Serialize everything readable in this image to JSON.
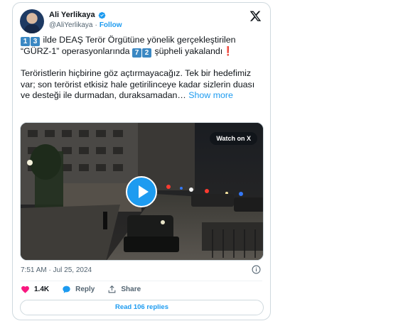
{
  "author": {
    "name": "Ali Yerlikaya",
    "handle": "@AliYerlikaya",
    "follow_label": "Follow",
    "separator": "·"
  },
  "tweet": {
    "line1_keycaps": [
      "1",
      "3"
    ],
    "line1_text": " ilde DEAŞ Terör Örgütüne yönelik gerçekleştirilen",
    "line2_text": "“GÜRZ-1” operasyonlarında ",
    "line2_keycaps": [
      "7",
      "2"
    ],
    "line2_tail": " şüpheli yakalandı",
    "line2_emoji": "❗",
    "para2": "Teröristlerin hiçbirine göz açtırmayacağız. Tek bir hedefimiz var; son terörist etkisiz hale getirilinceye kadar sizlerin duası ve desteği ile durmadan, duraksamadan…",
    "show_more": "Show more"
  },
  "media": {
    "watch_label": "Watch on X"
  },
  "meta": {
    "time": "7:51 AM",
    "separator": "·",
    "date": "Jul 25, 2024"
  },
  "actions": {
    "like_count": "1.4K",
    "reply_label": "Reply",
    "share_label": "Share"
  },
  "footer": {
    "read_replies": "Read 106 replies"
  },
  "colors": {
    "accent": "#1d9bf0",
    "like": "#f91880",
    "text_secondary": "#536471"
  }
}
